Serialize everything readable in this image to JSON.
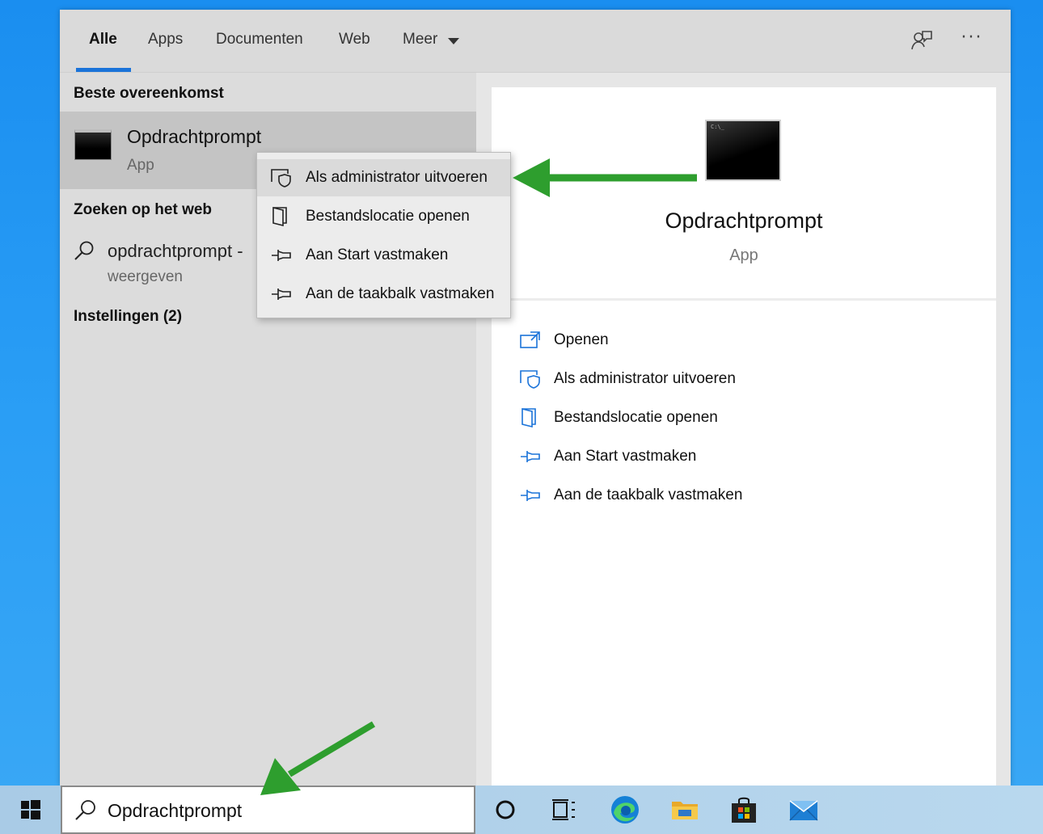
{
  "tabs": [
    {
      "label": "Alle",
      "active": true
    },
    {
      "label": "Apps"
    },
    {
      "label": "Documenten"
    },
    {
      "label": "Web"
    },
    {
      "label": "Meer"
    }
  ],
  "left": {
    "best_match_header": "Beste overeenkomst",
    "best_match": {
      "title": "Opdrachtprompt",
      "type": "App"
    },
    "web_header": "Zoeken op het web",
    "web_result": {
      "query": "opdrachtprompt -",
      "sub": "weergeven"
    },
    "settings_header": "Instellingen (2)"
  },
  "context_menu": {
    "items": [
      {
        "label": "Als administrator uitvoeren",
        "icon": "shield-admin-icon"
      },
      {
        "label": "Bestandslocatie openen",
        "icon": "file-location-icon"
      },
      {
        "label": "Aan Start vastmaken",
        "icon": "pin-icon"
      },
      {
        "label": "Aan de taakbalk vastmaken",
        "icon": "pin-icon"
      }
    ]
  },
  "preview": {
    "title": "Opdrachtprompt",
    "type": "App",
    "actions": [
      {
        "label": "Openen",
        "icon": "open-icon"
      },
      {
        "label": "Als administrator uitvoeren",
        "icon": "shield-admin-icon"
      },
      {
        "label": "Bestandslocatie openen",
        "icon": "file-location-icon"
      },
      {
        "label": "Aan Start vastmaken",
        "icon": "pin-icon"
      },
      {
        "label": "Aan de taakbalk vastmaken",
        "icon": "pin-icon"
      }
    ]
  },
  "taskbar": {
    "search_value": "Opdrachtprompt",
    "icons": [
      "cortana-icon",
      "task-view-icon",
      "edge-icon",
      "file-explorer-icon",
      "store-icon",
      "mail-icon"
    ]
  },
  "colors": {
    "accent": "#1a73d9",
    "annotation_arrow": "#2e9e2e",
    "icon_blue": "#1a73d9"
  }
}
